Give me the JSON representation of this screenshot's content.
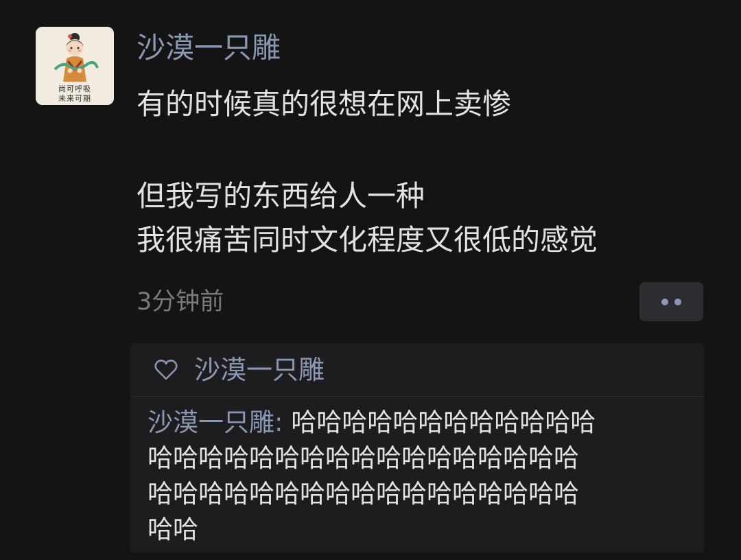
{
  "post": {
    "avatar": {
      "caption_line1": "尚可呼吸",
      "caption_line2": "未来可期"
    },
    "author": "沙漠一只雕",
    "text_lines": [
      "有的时候真的很想在网上卖惨",
      "",
      "但我写的东西给人一种",
      "我很痛苦同时文化程度又很低的感觉"
    ],
    "timestamp": "3分钟前",
    "more_icon": "more-dots-icon"
  },
  "interactions": {
    "like_icon": "heart-icon",
    "likes": [
      "沙漠一只雕"
    ],
    "comments": [
      {
        "author": "沙漠一只雕",
        "separator": ": ",
        "text_lines": [
          "哈哈哈哈哈哈哈哈哈哈哈哈",
          "哈哈哈哈哈哈哈哈哈哈哈哈哈哈哈哈哈",
          "哈哈哈哈哈哈哈哈哈哈哈哈哈哈哈哈哈",
          "哈哈"
        ]
      }
    ]
  },
  "colors": {
    "background": "#141414",
    "name_link": "#8a97b3",
    "body_text": "#e2e2e2",
    "timestamp": "#7a7a7a",
    "panel": "#1d1d1f"
  }
}
